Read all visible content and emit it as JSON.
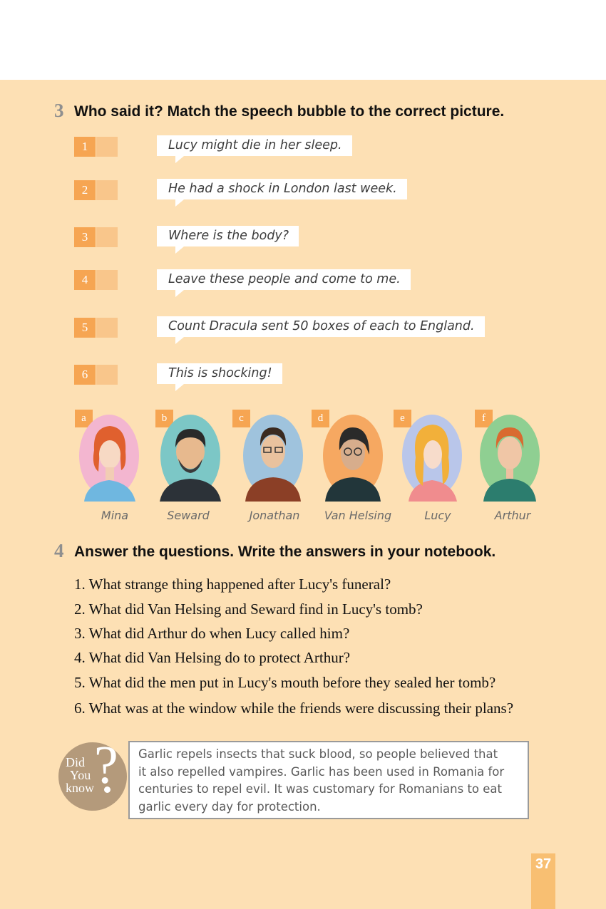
{
  "page": {
    "number": "37"
  },
  "exercise3": {
    "number": "3",
    "instruction": "Who said it? Match the speech bubble to the correct picture.",
    "items": [
      {
        "num": "1",
        "quote": "Lucy might die in her sleep."
      },
      {
        "num": "2",
        "quote": "He had a shock in London last week."
      },
      {
        "num": "3",
        "quote": "Where is the body?"
      },
      {
        "num": "4",
        "quote": "Leave these people and come to me."
      },
      {
        "num": "5",
        "quote": "Count Dracula sent 50 boxes of each to England."
      },
      {
        "num": "6",
        "quote": "This is shocking!"
      }
    ],
    "characters": [
      {
        "letter": "a",
        "name": "Mina",
        "bg": "#f3b6d0"
      },
      {
        "letter": "b",
        "name": "Seward",
        "bg": "#7cc7c6"
      },
      {
        "letter": "c",
        "name": "Jonathan",
        "bg": "#9fc3dd"
      },
      {
        "letter": "d",
        "name": "Van Helsing",
        "bg": "#f6a861"
      },
      {
        "letter": "e",
        "name": "Lucy",
        "bg": "#b9c6ea"
      },
      {
        "letter": "f",
        "name": "Arthur",
        "bg": "#8fcf92"
      }
    ]
  },
  "exercise4": {
    "number": "4",
    "instruction": "Answer the questions. Write the answers in your notebook.",
    "questions": [
      "1. What strange thing happened after Lucy's funeral?",
      "2. What did Van Helsing and Seward find in Lucy's tomb?",
      "3. What did Arthur do when Lucy called him?",
      "4. What did Van Helsing do to protect Arthur?",
      "5. What did the men put in Lucy's mouth before they sealed her tomb?",
      "6. What was at the window while the friends were discussing their plans?"
    ]
  },
  "did_you_know": {
    "label_line1": "Did",
    "label_line2": "You",
    "label_line3": "know",
    "lines": [
      "Garlic repels insects that suck blood, so people believed that",
      "it also repelled vampires. Garlic has been used in Romania for",
      "centuries to repel evil. It was customary for Romanians to eat",
      "garlic every day for protection."
    ]
  },
  "colors": {
    "page_background": "#fde0b4",
    "number_box": "#f6a552",
    "answer_box": "#f9c68b",
    "dyk_circle": "#b49a7b"
  }
}
